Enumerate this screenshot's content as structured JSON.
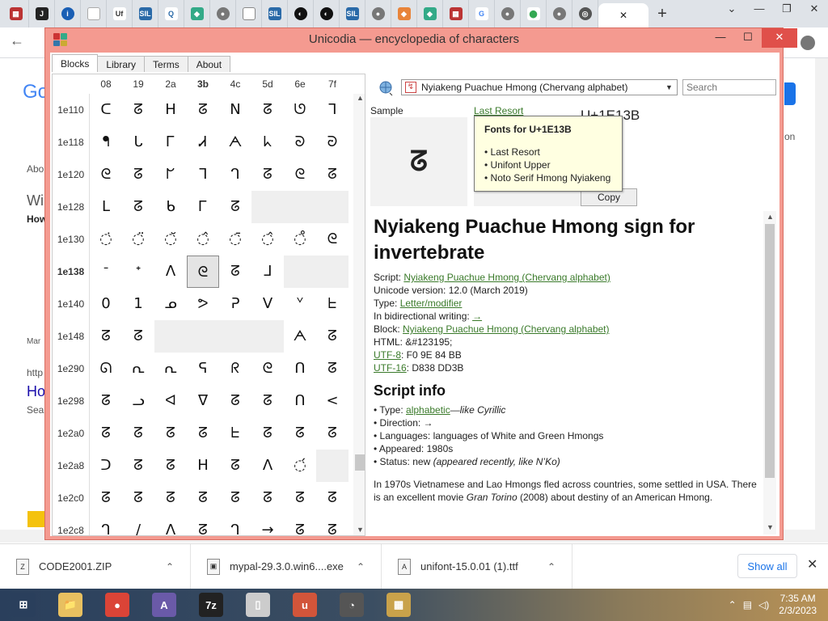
{
  "browser": {
    "window_controls": {
      "minimize": "—",
      "restore": "❐",
      "close": "✕",
      "chevron": "⌄"
    },
    "new_tab": "+",
    "active_tab_close": "✕",
    "page_fragments": [
      "Goo",
      "Abo",
      "Wi",
      "How",
      "Mar",
      "http",
      "Ho",
      "Sea",
      "on"
    ]
  },
  "downloads": {
    "items": [
      {
        "name": "CODE2001.ZIP"
      },
      {
        "name": "mypal-29.3.0.win6....exe"
      },
      {
        "name": "unifont-15.0.01 (1).ttf"
      }
    ],
    "show_all": "Show all",
    "close": "✕",
    "chevron": "⌃"
  },
  "taskbar": {
    "time": "7:35 AM",
    "date": "2/3/2023",
    "apps": [
      {
        "name": "windows-start",
        "label": "⊞",
        "color": "#2a3f5c"
      },
      {
        "name": "file-explorer",
        "label": "📁",
        "color": "#e8c060"
      },
      {
        "name": "chrome",
        "label": "●",
        "color": "#db4437"
      },
      {
        "name": "char-map",
        "label": "A",
        "color": "#6a5aa8"
      },
      {
        "name": "7zip",
        "label": "7z",
        "color": "#222"
      },
      {
        "name": "notepad",
        "label": "▯",
        "color": "#ccc"
      },
      {
        "name": "app-red",
        "label": "u",
        "color": "#d2553a"
      },
      {
        "name": "raccoon",
        "label": "◔",
        "color": "#555"
      },
      {
        "name": "unicodia",
        "label": "▦",
        "color": "#c9a24a"
      }
    ]
  },
  "app": {
    "title": "Unicodia — encyclopedia of characters",
    "controls": {
      "minimize": "—",
      "maximize": "☐",
      "close": "✕"
    },
    "tabs": [
      "Blocks",
      "Library",
      "Terms",
      "About"
    ],
    "active_tab": "Blocks",
    "grid": {
      "columns": [
        "08",
        "19",
        "2a",
        "3b",
        "4c",
        "5d",
        "6e",
        "7f"
      ],
      "bold_column": "3b",
      "rows": [
        {
          "label": "1e110",
          "cells": [
            "ᑕ",
            "ᘔ",
            "ᕼ",
            "ᘔ",
            "N",
            "ᘔ",
            "ᘎ",
            "ᒣ"
          ]
        },
        {
          "label": "1e118",
          "cells": [
            "ᖳ",
            "ᒐ",
            "Ꮁ",
            "Ꮧ",
            "ᗅ",
            "ᖾ",
            "ᘐ",
            "ᘒ"
          ]
        },
        {
          "label": "1e120",
          "cells": [
            "ᘓ",
            "ᘔ",
            "ᖸ",
            "ᒣ",
            "ᒉ",
            "ᘔ",
            "ᘓ",
            "ᘔ"
          ]
        },
        {
          "label": "1e128",
          "cells": [
            "ᒪ",
            "ᘔ",
            "ᑲ",
            "Ꮁ",
            "ᘔ",
            "",
            "",
            ""
          ]
        },
        {
          "label": "1e130",
          "cells": [
            "◌̇",
            "◌̈",
            "◌̆",
            "◌̂",
            "◌̄",
            "◌̂",
            "◌̊",
            "ᘓ"
          ]
        },
        {
          "label": "1e138",
          "cells": [
            "ᐨ",
            "ᐩ",
            "ᐱ",
            "ᘓ",
            "ᘔ",
            "ᒧ",
            "",
            ""
          ]
        },
        {
          "label": "1e140",
          "cells": [
            "0",
            "1",
            "ᓄ",
            "ᕗ",
            "ᕈ",
            "V",
            "ᘁ",
            "ᖶ"
          ]
        },
        {
          "label": "1e148",
          "cells": [
            "ᘔ",
            "ᘔ",
            "",
            "",
            "",
            "",
            "ᗅ",
            "ᘔ"
          ]
        },
        {
          "label": "1e290",
          "cells": [
            "ᘏ",
            "ᕆ",
            "ᕆ",
            "ᕋ",
            "ᖇ",
            "ᘓ",
            "ᑎ",
            "ᘔ"
          ]
        },
        {
          "label": "1e298",
          "cells": [
            "ᘔ",
            "ᓗ",
            "ᐊ",
            "ᐁ",
            "ᘔ",
            "ᘔ",
            "ᑎ",
            "<"
          ]
        },
        {
          "label": "1e2a0",
          "cells": [
            "ᘔ",
            "ᘔ",
            "ᘔ",
            "ᘔ",
            "ᖶ",
            "ᘔ",
            "ᘔ",
            "ᘔ"
          ]
        },
        {
          "label": "1e2a8",
          "cells": [
            "ᑐ",
            "ᘔ",
            "ᘔ",
            "H",
            "ᘔ",
            "ᐱ",
            "◌́",
            ""
          ]
        },
        {
          "label": "1e2c0",
          "cells": [
            "ᘔ",
            "ᘔ",
            "ᘔ",
            "ᘔ",
            "ᘔ",
            "ᘔ",
            "ᘔ",
            "ᘔ"
          ]
        },
        {
          "label": "1e2c8",
          "cells": [
            "ᒉ",
            "/",
            "ᐱ",
            "ᘔ",
            "ᒉ",
            "→",
            "ᘔ",
            "ᘔ"
          ]
        }
      ],
      "bold_row": "1e138",
      "selected": {
        "row": "1e138",
        "col": "3b"
      }
    },
    "right": {
      "script_combo": "Nyiakeng Puachue Hmong (Chervang alphabet)",
      "search_placeholder": "Search",
      "sample_label": "Sample",
      "sample_char": "ᘔ",
      "fonts_link": "Last Resort",
      "code_point": "U+1E13B",
      "copy": "Copy",
      "tooltip": {
        "title": "Fonts for U+1E13B",
        "items": [
          "• Last Resort",
          "• Unifont Upper",
          "• Noto Serif Hmong Nyiakeng"
        ]
      },
      "char_title": "Nyiakeng Puachue Hmong sign for invertebrate",
      "props": {
        "script_label": "Script: ",
        "script_value": "Nyiakeng Puachue Hmong (Chervang alphabet)",
        "version": "Unicode version: 12.0 (March 2019)",
        "type_label": "Type: ",
        "type_value": "Letter/modifier",
        "bidi_label": "In bidirectional writing: ",
        "bidi_value": "→",
        "block_label": "Block: ",
        "block_value": "Nyiakeng Puachue Hmong (Chervang alphabet)",
        "html": "HTML: &#123195;",
        "utf8_label": "UTF-8",
        "utf8_value": ": F0 9E 84 BB",
        "utf16_label": "UTF-16",
        "utf16_value": ": D838 DD3B"
      },
      "script_info_title": "Script info",
      "script_info": {
        "type_label": "• Type: ",
        "type_value": "alphabetic",
        "type_like": "—like Cyrillic",
        "direction": "• Direction: →",
        "languages": "• Languages: languages of White and Green Hmongs",
        "appeared": "• Appeared: 1980s",
        "status_label": "• Status: new ",
        "status_value": "(appeared recently, like N’Ko)"
      },
      "para1": "In 1970s Vietnamese and Lao Hmongs fled across countries, some settled in USA. There is an excellent movie ",
      "para_movie": "Gran Torino",
      "para2": " (2008) about destiny of an American Hmong."
    }
  }
}
